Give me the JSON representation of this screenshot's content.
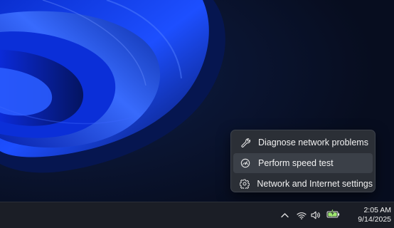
{
  "context_menu": {
    "items": [
      {
        "label": "Diagnose network problems",
        "icon": "wrench-icon"
      },
      {
        "label": "Perform speed test",
        "icon": "speedometer-icon"
      },
      {
        "label": "Network and Internet settings",
        "icon": "gear-icon"
      }
    ],
    "highlighted_item": "Perform speed test"
  },
  "taskbar": {
    "tray_icons": [
      "chevron-up-icon",
      "wifi-icon",
      "volume-icon",
      "battery-charging-icon"
    ],
    "clock": {
      "time": "2:05 AM",
      "date": "9/14/2025"
    }
  },
  "colors": {
    "menu_background": "#2b2f36",
    "menu_highlight": "#3b4048",
    "taskbar_background": "#1b1e26",
    "battery_accent": "#9fe870",
    "wallpaper_blue": "#1d4fff"
  }
}
